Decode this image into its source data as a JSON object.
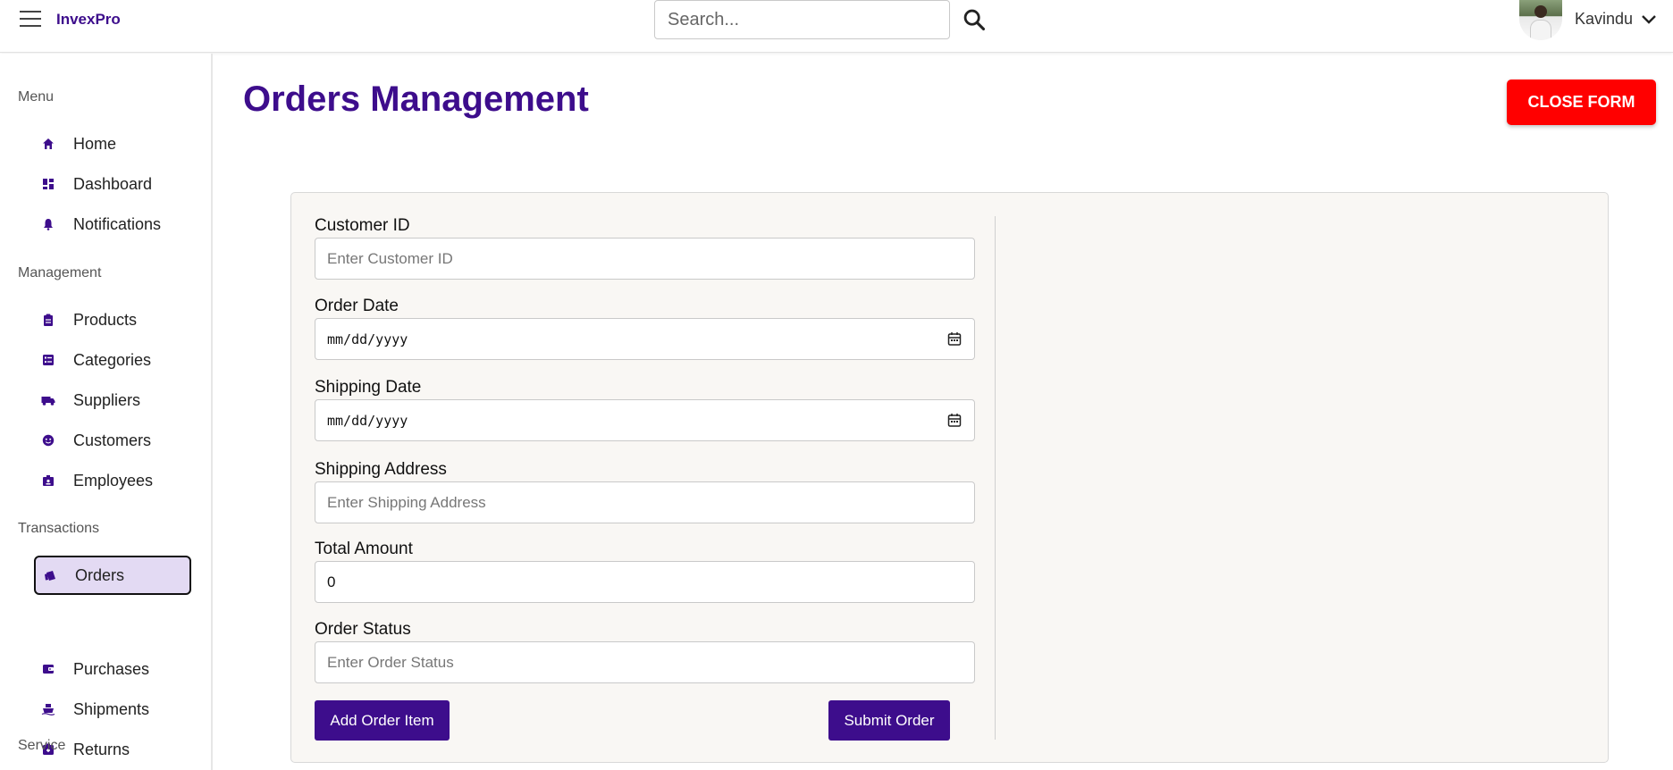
{
  "app": {
    "brand": "InvexPro"
  },
  "header": {
    "search_placeholder": "Search...",
    "user_name": "Kavindu"
  },
  "sidebar": {
    "sections": [
      {
        "title": "Menu",
        "items": [
          {
            "label": "Home",
            "icon": "home-icon"
          },
          {
            "label": "Dashboard",
            "icon": "dashboard-icon"
          },
          {
            "label": "Notifications",
            "icon": "bell-icon"
          }
        ]
      },
      {
        "title": "Management",
        "items": [
          {
            "label": "Products",
            "icon": "clipboard-icon"
          },
          {
            "label": "Categories",
            "icon": "list-icon"
          },
          {
            "label": "Suppliers",
            "icon": "truck-icon"
          },
          {
            "label": "Customers",
            "icon": "face-icon"
          },
          {
            "label": "Employees",
            "icon": "badge-icon"
          }
        ]
      },
      {
        "title": "Transactions",
        "items": [
          {
            "label": "Orders",
            "icon": "shopping-bag-icon",
            "active": true
          },
          {
            "label": "Purchases",
            "icon": "wallet-icon"
          },
          {
            "label": "Shipments",
            "icon": "ship-icon"
          },
          {
            "label": "Returns",
            "icon": "return-box-icon"
          }
        ]
      },
      {
        "title": "Service",
        "items": []
      }
    ]
  },
  "main": {
    "title": "Orders Management",
    "close_button": "CLOSE FORM",
    "form": {
      "fields": [
        {
          "label": "Customer ID",
          "placeholder": "Enter Customer ID",
          "value": ""
        },
        {
          "label": "Order Date",
          "placeholder": "mm/dd/yyyy",
          "value": ""
        },
        {
          "label": "Shipping Date",
          "placeholder": "mm/dd/yyyy",
          "value": ""
        },
        {
          "label": "Shipping Address",
          "placeholder": "Enter Shipping Address",
          "value": ""
        },
        {
          "label": "Total Amount",
          "placeholder": "",
          "value": "0"
        },
        {
          "label": "Order Status",
          "placeholder": "Enter Order Status",
          "value": ""
        }
      ],
      "add_item_button": "Add Order Item",
      "submit_button": "Submit Order"
    }
  },
  "colors": {
    "brand": "#3d0d8c",
    "danger": "#ff0000",
    "active_bg": "#e3daf3"
  }
}
